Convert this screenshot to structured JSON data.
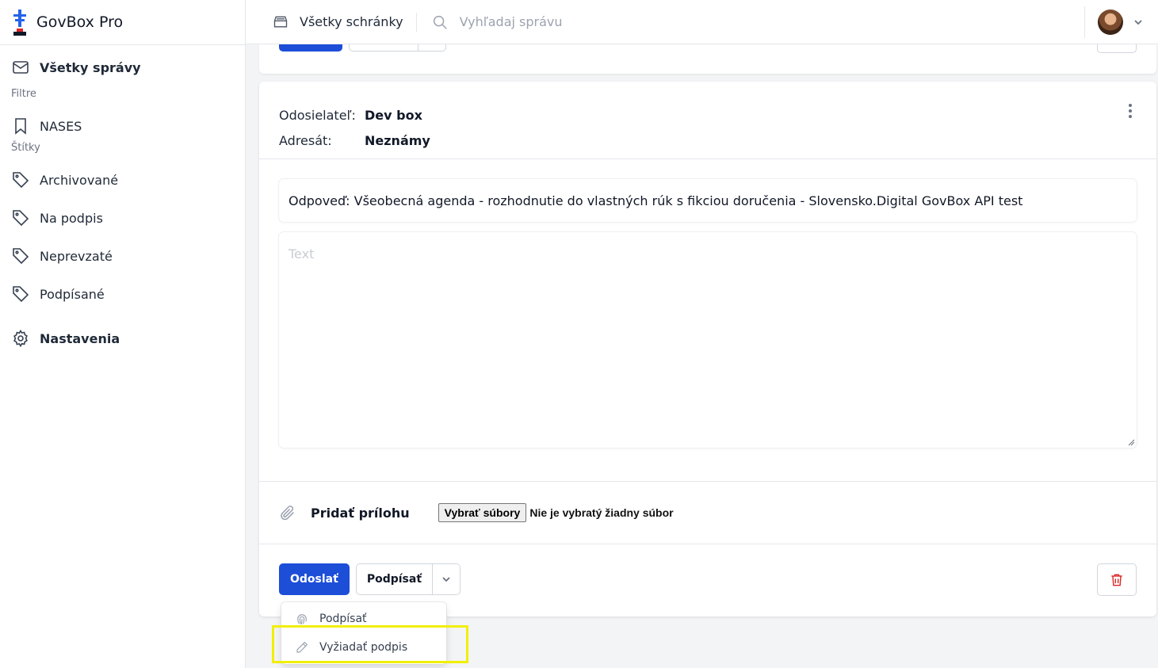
{
  "app": {
    "name": "GovBox Pro"
  },
  "sidebar": {
    "all_messages": "Všetky správy",
    "filters_label": "Filtre",
    "filters": [
      {
        "label": "NASES"
      }
    ],
    "tags_label": "Štítky",
    "tags": [
      {
        "label": "Archivované"
      },
      {
        "label": "Na podpis"
      },
      {
        "label": "Neprevzaté"
      },
      {
        "label": "Podpísané"
      }
    ],
    "settings": "Nastavenia"
  },
  "topbar": {
    "boxes_label": "Všetky schránky",
    "search_placeholder": "Vyhľadaj správu"
  },
  "message": {
    "sender_label": "Odosielateľ:",
    "sender_value": "Dev box",
    "recipient_label": "Adresát:",
    "recipient_value": "Neznámy",
    "subject": "Odpoveď: Všeobecná agenda - rozhodnutie do vlastných rúk s fikciou doručenia - Slovensko.Digital GovBox API test",
    "body_placeholder": "Text"
  },
  "attachment": {
    "label": "Pridať prílohu",
    "choose_files": "Vybrať súbory",
    "no_file": "Nie je vybratý žiadny súbor"
  },
  "actions": {
    "send": "Odoslať",
    "sign": "Podpísať"
  },
  "dropdown": {
    "items": [
      {
        "label": "Podpísať",
        "icon": "fingerprint-icon"
      },
      {
        "label": "Vyžiadať podpis",
        "icon": "pencil-icon"
      }
    ]
  },
  "colors": {
    "primary": "#1d4ed8",
    "danger": "#dc2626",
    "highlight": "#f1ef05"
  }
}
